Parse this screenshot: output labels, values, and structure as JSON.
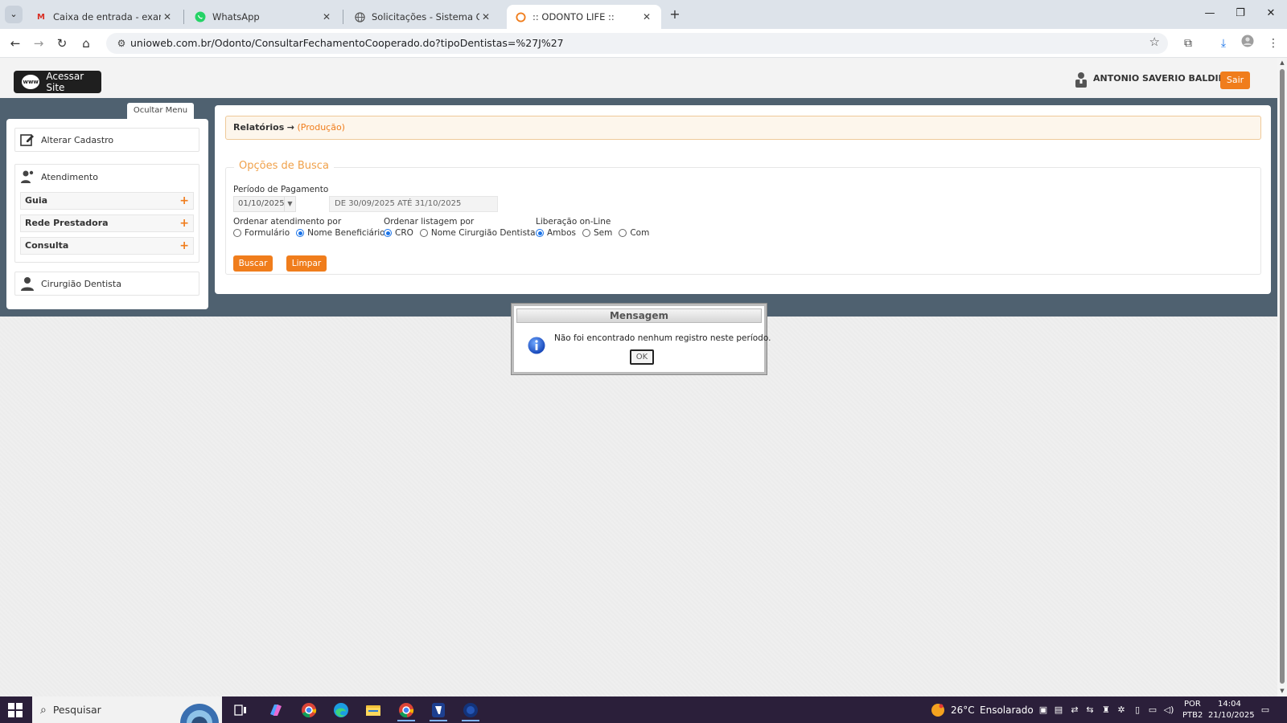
{
  "browser": {
    "tabs": [
      {
        "title": "Caixa de entrada - examesclinic",
        "favicon": "gmail-icon"
      },
      {
        "title": "WhatsApp",
        "favicon": "whatsapp-icon"
      },
      {
        "title": "Solicitações - Sistema Clínica",
        "favicon": "globe-icon"
      },
      {
        "title": ":: ODONTO LIFE ::",
        "favicon": "odonto-icon",
        "active": true
      }
    ],
    "url": "unioweb.com.br/Odonto/ConsultarFechamentoCooperado.do?tipoDentistas=%27J%27"
  },
  "header": {
    "site_button": "Acessar Site",
    "www_badge": "www",
    "user_name": "ANTONIO SAVERIO BALDINU",
    "logout": "Sair"
  },
  "sidebar": {
    "hide_menu": "Ocultar Menu",
    "alter_cadastro": "Alterar Cadastro",
    "atendimento": "Atendimento",
    "sub_items": [
      "Guia",
      "Rede Prestadora",
      "Consulta"
    ],
    "cirurgiao": "Cirurgião Dentista"
  },
  "content": {
    "breadcrumb_root": "Relatórios",
    "breadcrumb_arrow": "→",
    "breadcrumb_link": "(Produção)",
    "legend": "Opções de Busca",
    "periodo_label": "Período de Pagamento",
    "periodo_value": "01/10/2025",
    "periodo_range": "DE 30/09/2025 ATÉ 31/10/2025",
    "ordenar_atendimento_label": "Ordenar atendimento por",
    "ordenar_atendimento_options": [
      "Formulário",
      "Nome Beneficiário"
    ],
    "ordenar_atendimento_selected": "Nome Beneficiário",
    "ordenar_listagem_label": "Ordenar listagem por",
    "ordenar_listagem_options": [
      "CRO",
      "Nome Cirurgião Dentista"
    ],
    "ordenar_listagem_selected": "CRO",
    "liberacao_label": "Liberação on-Line",
    "liberacao_options": [
      "Ambos",
      "Sem",
      "Com"
    ],
    "liberacao_selected": "Ambos",
    "buscar": "Buscar",
    "limpar": "Limpar"
  },
  "modal": {
    "title": "Mensagem",
    "message": "Não foi encontrado nenhum registro neste período.",
    "ok": "OK"
  },
  "taskbar": {
    "search_placeholder": "Pesquisar",
    "weather_temp": "26°C",
    "weather_text": "Ensolarado",
    "lang_top": "POR",
    "lang_bottom": "PTB2",
    "time": "14:04",
    "date": "21/10/2025"
  },
  "colors": {
    "accent_orange": "#f07d1c",
    "band_slate": "#4f6170",
    "legend_orange": "#f0a14a"
  }
}
